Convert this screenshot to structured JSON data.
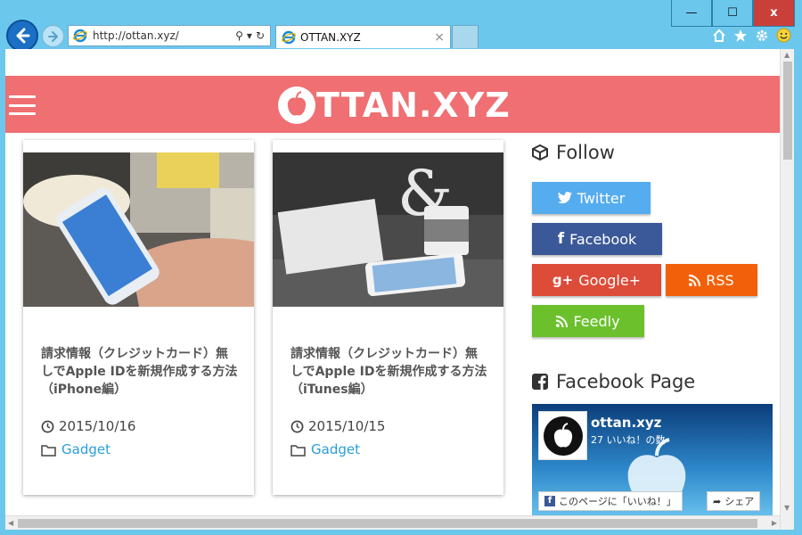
{
  "browser": {
    "url": "http://ottan.xyz/",
    "tab_title": "OTTAN.XYZ",
    "tab_close": "×",
    "window_controls": {
      "minimize": "—",
      "maximize": "☐",
      "close": "x"
    },
    "toolbar_icons": [
      "home-icon",
      "star-icon",
      "gear-icon",
      "smiley-icon"
    ]
  },
  "site": {
    "logo_text": "TTAN.XYZ",
    "brand_color": "#ef6f72"
  },
  "posts": [
    {
      "title": "請求情報（クレジットカード）無しでApple IDを新規作成する方法（iPhone編）",
      "date": "2015/10/16",
      "category": "Gadget"
    },
    {
      "title": "請求情報（クレジットカード）無しでApple IDを新規作成する方法（iTunes編）",
      "date": "2015/10/15",
      "category": "Gadget"
    }
  ],
  "sidebar": {
    "follow_heading": "Follow",
    "buttons": {
      "twitter": {
        "label": "Twitter",
        "color": "#55acee"
      },
      "facebook": {
        "label": "Facebook",
        "color": "#3b5998"
      },
      "googleplus": {
        "label": "Google+",
        "color": "#dd4b39"
      },
      "rss": {
        "label": "RSS",
        "color": "#f26109"
      },
      "feedly": {
        "label": "Feedly",
        "color": "#6cc02c"
      }
    },
    "fb_heading": "Facebook Page",
    "fb_page": {
      "name": "ottan.xyz",
      "likes": "27 いいね！の数",
      "like_button": "このページに「いいね！」",
      "share_button": "シェア"
    }
  }
}
